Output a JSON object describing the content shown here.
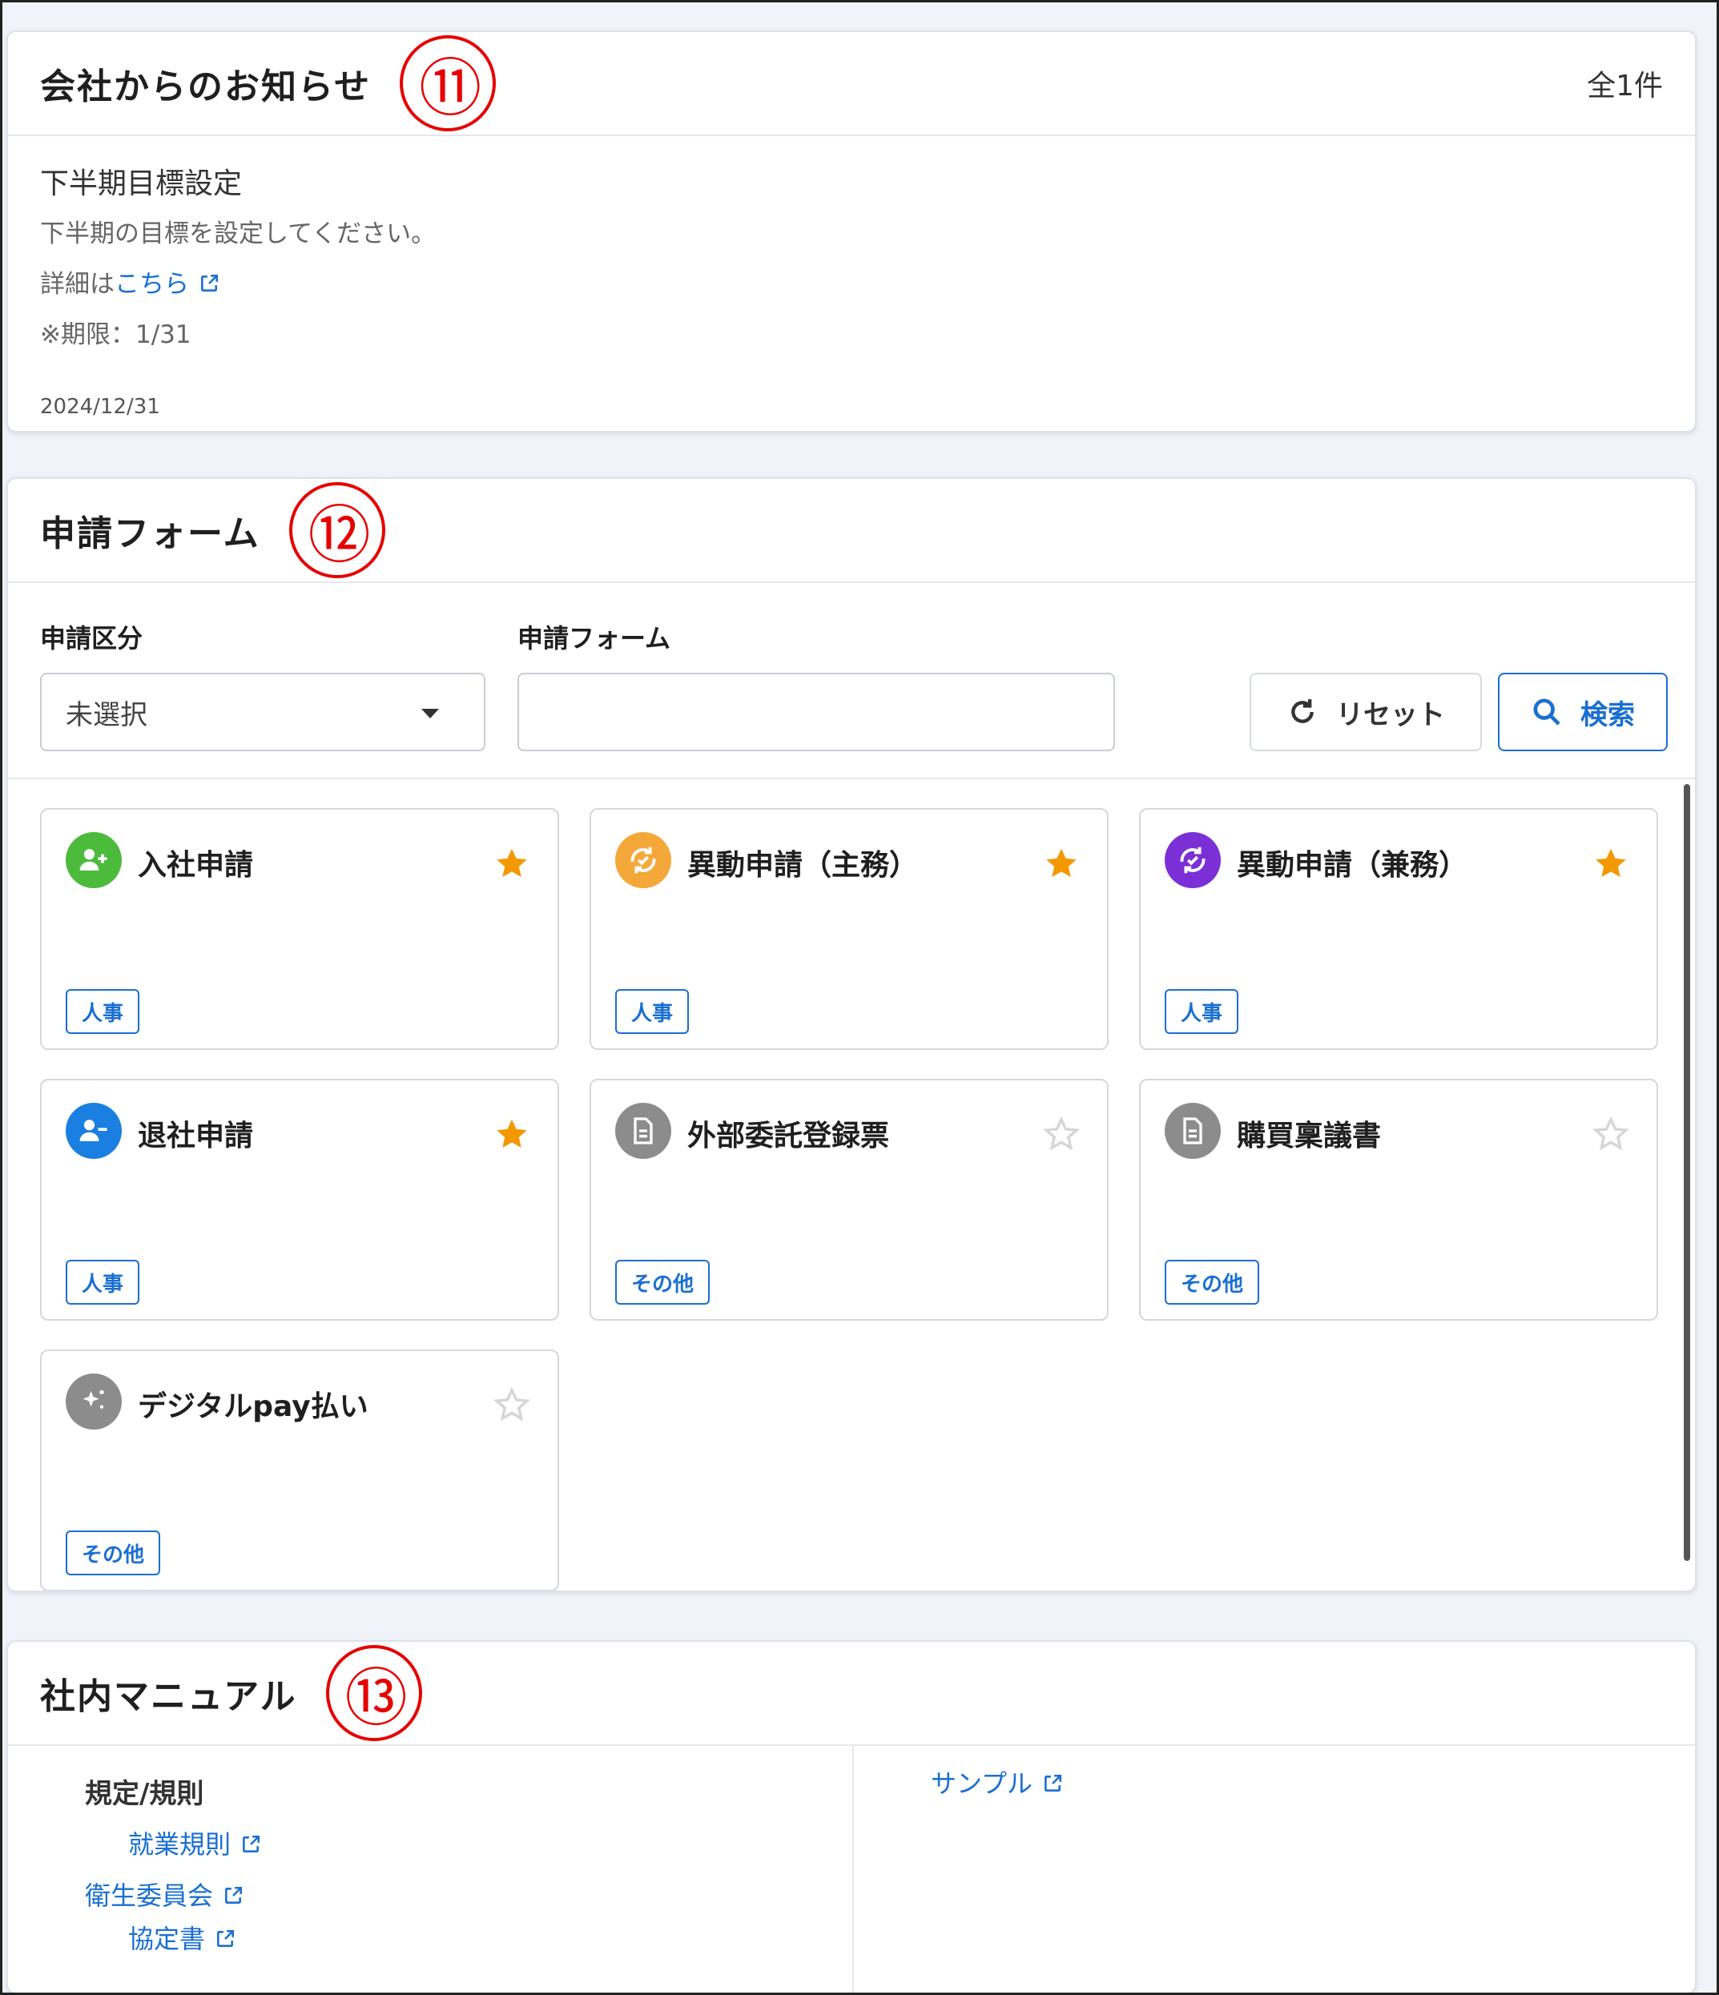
{
  "notice": {
    "title": "会社からのお知らせ",
    "marker": "⑪",
    "count": "全1件",
    "item": {
      "heading": "下半期目標設定",
      "body": "下半期の目標を設定してください。",
      "detail_prefix": "詳細は",
      "detail_link": "こちら",
      "deadline": "※期限：1/31",
      "date": "2024/12/31"
    }
  },
  "forms": {
    "title": "申請フォーム",
    "marker": "⑫",
    "filter_category_label": "申請区分",
    "filter_form_label": "申請フォーム",
    "category_value": "未選択",
    "form_value": "",
    "reset_label": "リセット",
    "search_label": "検索",
    "items": [
      {
        "name": "入社申請",
        "tag": "人事",
        "icon": "person-add-icon",
        "favorite": true
      },
      {
        "name": "異動申請（主務）",
        "tag": "人事",
        "icon": "transfer-icon",
        "favorite": true
      },
      {
        "name": "異動申請（兼務）",
        "tag": "人事",
        "icon": "transfer-icon",
        "favorite": true
      },
      {
        "name": "退社申請",
        "tag": "人事",
        "icon": "person-remove-icon",
        "favorite": true
      },
      {
        "name": "外部委託登録票",
        "tag": "その他",
        "icon": "document-icon",
        "favorite": false
      },
      {
        "name": "購買稟議書",
        "tag": "その他",
        "icon": "document-icon",
        "favorite": false
      },
      {
        "name": "デジタルpay払い",
        "tag": "その他",
        "icon": "sparkle-icon",
        "favorite": false
      }
    ],
    "colors": {
      "green": "#4cbb3c",
      "orange": "#f5a83a",
      "purple": "#7b2fd6",
      "blue": "#1a7fe0",
      "gray": "#8c8c8c",
      "star_on": "#f39800",
      "star_off": "#d6d6d6"
    }
  },
  "manual": {
    "title": "社内マニュアル",
    "marker": "⑬",
    "category": "規定/規則",
    "links": {
      "rules": "就業規則",
      "committee": "衛生委員会",
      "agreement": "協定書",
      "sample": "サンプル"
    }
  }
}
